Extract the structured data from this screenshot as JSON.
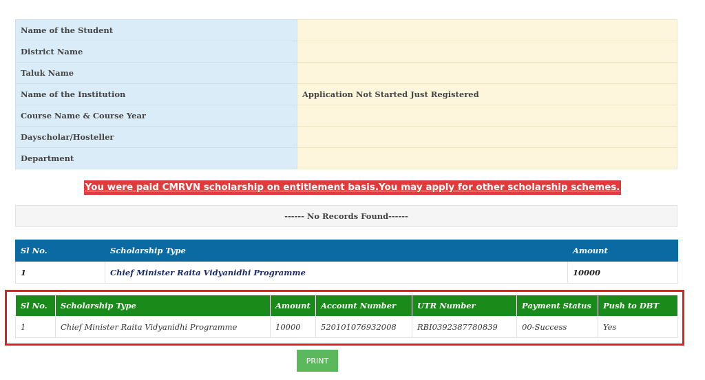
{
  "details": [
    {
      "label": "Name of the Student",
      "value": ""
    },
    {
      "label": "District Name",
      "value": ""
    },
    {
      "label": "Taluk Name",
      "value": ""
    },
    {
      "label": "Name of the Institution",
      "value": "Application Not Started Just Registered"
    },
    {
      "label": "Course Name & Course Year",
      "value": ""
    },
    {
      "label": "Dayscholar/Hosteller",
      "value": ""
    },
    {
      "label": "Department",
      "value": ""
    }
  ],
  "notice": "You were paid CMRVN scholarship on entitlement basis.You may apply for other scholarship schemes.",
  "no_records": "------ No Records Found------",
  "scholarship_table": {
    "headers": [
      "Sl No.",
      "Scholarship Type",
      "Amount"
    ],
    "rows": [
      [
        "1",
        "Chief Minister Raita Vidyanidhi Programme",
        "10000"
      ]
    ]
  },
  "payment_table": {
    "headers": [
      "Sl No.",
      "Scholarship Type",
      "Amount",
      "Account Number",
      "UTR Number",
      "Payment Status",
      "Push to DBT"
    ],
    "rows": [
      [
        "1",
        "Chief Minister Raita Vidyanidhi Programme",
        "10000",
        "520101076932008",
        "RBI0392387780839",
        "00-Success",
        "Yes"
      ]
    ]
  },
  "print_label": "PRINT",
  "colors": {
    "label_bg": "#d9ecf8",
    "value_bg": "#fdf6dc",
    "notice_bg": "#e03a3a",
    "blue_header": "#0a6aa1",
    "green_header": "#1a8a1a",
    "highlight_border": "#e02020",
    "print_button": "#5cb85c"
  }
}
